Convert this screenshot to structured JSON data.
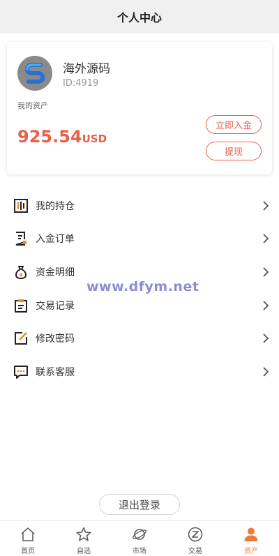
{
  "header": {
    "title": "个人中心"
  },
  "profile": {
    "name": "海外源码",
    "id_text": "ID:4919",
    "avatar_letter": "S"
  },
  "assets": {
    "label": "我的资产",
    "amount": "925.54",
    "unit": "USD",
    "deposit_label": "立即入金",
    "withdraw_label": "提现"
  },
  "menu": [
    {
      "label": "我的持仓",
      "icon": "holdings-icon"
    },
    {
      "label": "入金订单",
      "icon": "deposit-order-icon"
    },
    {
      "label": "资金明细",
      "icon": "money-bag-icon"
    },
    {
      "label": "交易记录",
      "icon": "clipboard-icon"
    },
    {
      "label": "修改密码",
      "icon": "edit-icon"
    },
    {
      "label": "联系客服",
      "icon": "chat-icon"
    }
  ],
  "watermark": "www.dfym.net",
  "logout_label": "退出登录",
  "tabbar": [
    {
      "label": "首页",
      "icon": "home-icon",
      "active": false
    },
    {
      "label": "自选",
      "icon": "star-icon",
      "active": false
    },
    {
      "label": "市场",
      "icon": "planet-icon",
      "active": false
    },
    {
      "label": "交易",
      "icon": "exchange-icon",
      "active": false
    },
    {
      "label": "资产",
      "icon": "user-icon",
      "active": true
    }
  ],
  "colors": {
    "accent": "#e8604c",
    "tab_active": "#f07a3e",
    "icon_orange": "#f08a24"
  }
}
